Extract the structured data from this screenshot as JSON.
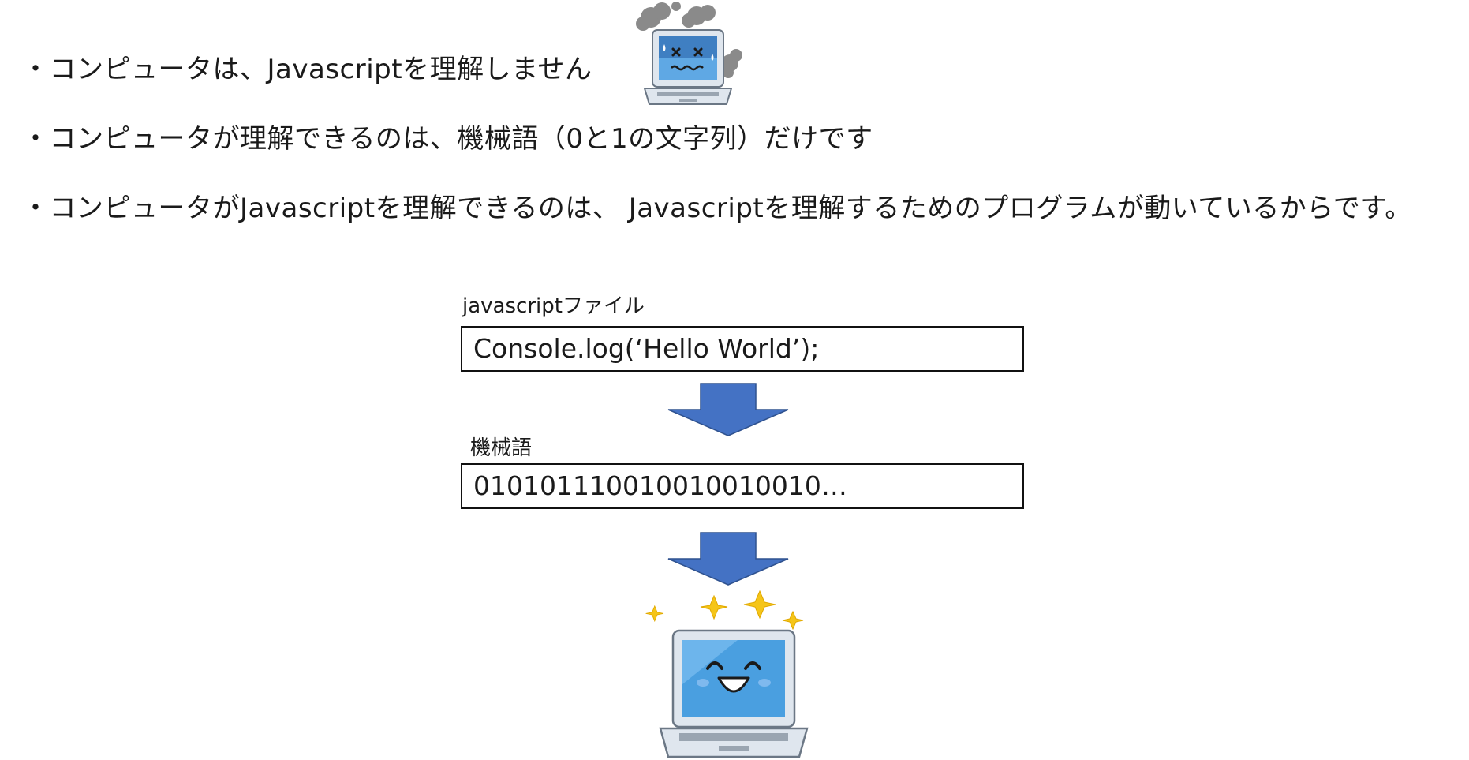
{
  "bullets": [
    "・コンピュータは、Javascriptを理解しません",
    "・コンピュータが理解できるのは、機械語（0と1の文字列）だけです",
    "・コンピュータがJavascriptを理解できるのは、 Javascriptを理解するためのプログラムが動いているからです。"
  ],
  "flow": {
    "source_label": "javascriptファイル",
    "source_code": "Console.log(‘Hello World’);",
    "machine_label": "機械語",
    "machine_code": "010101110010010010010…"
  },
  "colors": {
    "arrow": "#4472C4",
    "arrow_stroke": "#2F528F",
    "screen_blue": "#4A9FE0",
    "sparkle": "#F5C518",
    "smoke": "#808080"
  },
  "icons": {
    "confused_computer": "broken-computer-icon",
    "happy_computer": "happy-computer-icon"
  }
}
